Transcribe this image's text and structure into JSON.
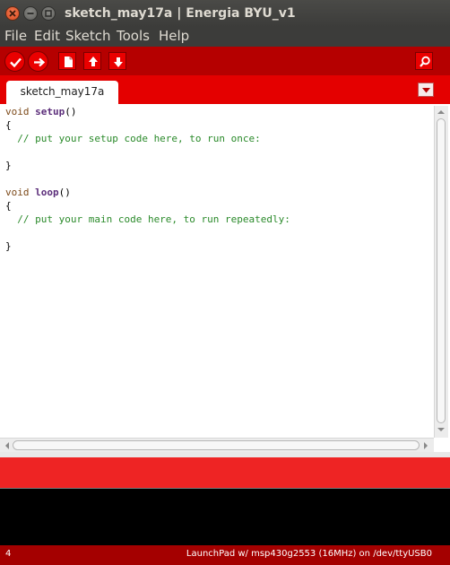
{
  "window": {
    "title": "sketch_may17a | Energia BYU_v1"
  },
  "menubar": {
    "items": [
      "File",
      "Edit",
      "Sketch",
      "Tools",
      "Help"
    ]
  },
  "toolbar": {
    "buttons": [
      "check-icon",
      "arrow-right-icon",
      "new-file-icon",
      "open-up-arrow-icon",
      "save-down-arrow-icon",
      "serial-monitor-icon"
    ]
  },
  "tabs": {
    "active": "sketch_may17a"
  },
  "editor": {
    "lines": [
      {
        "parts": [
          [
            "void",
            "void"
          ],
          [
            " ",
            "plain"
          ],
          [
            "setup",
            "fn"
          ],
          [
            "()",
            "plain"
          ]
        ]
      },
      {
        "parts": [
          [
            "{",
            "plain"
          ]
        ]
      },
      {
        "parts": [
          [
            "  // put your setup code here, to run once:",
            "comment"
          ]
        ]
      },
      {
        "parts": [
          [
            "",
            "plain"
          ]
        ]
      },
      {
        "parts": [
          [
            "}",
            "plain"
          ]
        ]
      },
      {
        "parts": [
          [
            "",
            "plain"
          ]
        ]
      },
      {
        "parts": [
          [
            "void",
            "void"
          ],
          [
            " ",
            "plain"
          ],
          [
            "loop",
            "fn"
          ],
          [
            "()",
            "plain"
          ]
        ]
      },
      {
        "parts": [
          [
            "{",
            "plain"
          ]
        ]
      },
      {
        "parts": [
          [
            "  // put your main code here, to run repeatedly:",
            "comment"
          ]
        ]
      },
      {
        "parts": [
          [
            "",
            "plain"
          ]
        ]
      },
      {
        "parts": [
          [
            "}",
            "plain"
          ]
        ]
      }
    ]
  },
  "status": {
    "line_number": "4",
    "board": "LaunchPad w/ msp430g2553 (16MHz) on /dev/ttyUSB0"
  },
  "colors": {
    "toolbar": "#b50000",
    "tabbar": "#e40000",
    "status_strip": "#ee2424",
    "bottombar": "#a40000",
    "comment": "#2a8a2a"
  }
}
